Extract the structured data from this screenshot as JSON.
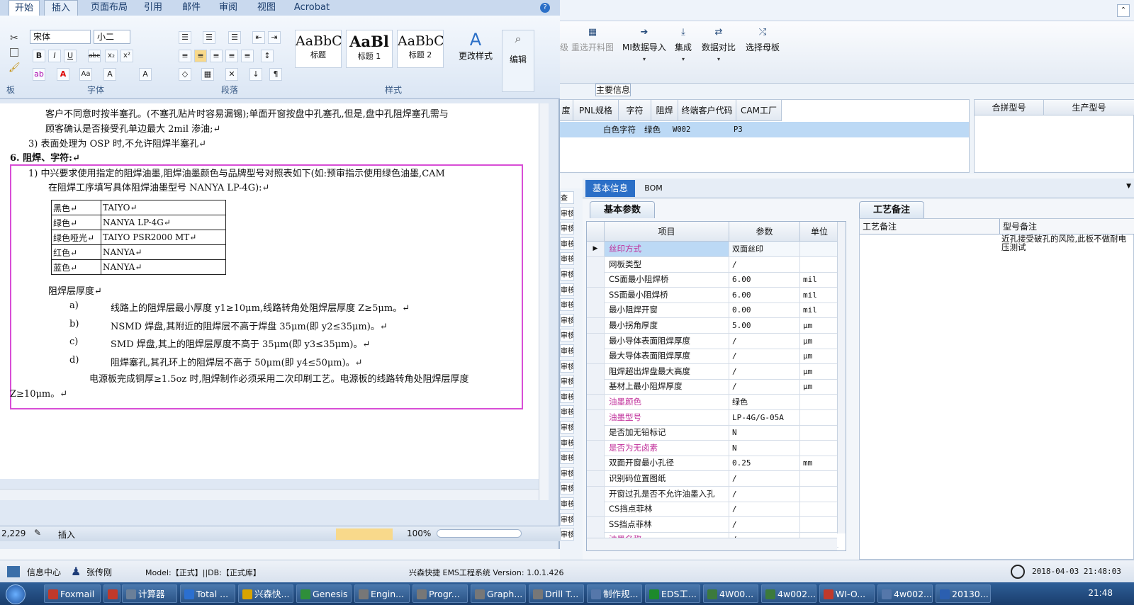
{
  "word": {
    "tabs": [
      "开始",
      "插入",
      "页面布局",
      "引用",
      "邮件",
      "审阅",
      "视图",
      "Acrobat"
    ],
    "font_name": "宋体",
    "font_size": "小二",
    "styles": [
      {
        "preview": "AaBbC",
        "label": "标题"
      },
      {
        "preview": "AaBl",
        "label": "标题 1"
      },
      {
        "preview": "AaBbC",
        "label": "标题 2"
      }
    ],
    "change_styles": "更改样式",
    "edit": "编辑",
    "groups": {
      "font": "字体",
      "paragraph": "段落",
      "styles": "样式",
      "clipboard": "板"
    },
    "doc": {
      "l1": "客户不同意时按半塞孔。(不塞孔贴片时容易漏锡);单面开窗按盘中孔塞孔,但是,盘中孔阻焊塞孔需与",
      "l2": "顾客确认是否接受孔单边最大 2mil 渗油;↵",
      "l3": "3)  表面处理为 OSP 时,不允许阻焊半塞孔↵",
      "l4": "6.   阻焊、字符:↵",
      "l5": "1) 中兴要求使用指定的阻焊油墨,阻焊油墨颜色与品牌型号对照表如下(如:预审指示使用绿色油墨,CAM",
      "l6": "在阻焊工序填写具体阻焊油墨型号 NANYA  LP-4G):↵",
      "ink_table": [
        [
          "黑色↵",
          "TAIYO↵"
        ],
        [
          "绿色↵",
          "NANYA  LP-4G↵"
        ],
        [
          "绿色哑光↵",
          "TAIYO   PSR2000  MT↵"
        ],
        [
          "红色↵",
          "NANYA↵"
        ],
        [
          "蓝色↵",
          "NANYA↵"
        ]
      ],
      "thick_title": "阻焊层厚度↵",
      "items": [
        {
          "k": "a)",
          "t": "线路上的阻焊层最小厚度 y1≥10μm,线路转角处阻焊层厚度 Z≥5μm。↵"
        },
        {
          "k": "b)",
          "t": "NSMD 焊盘,其附近的阻焊层不高于焊盘 35μm(即 y2≤35μm)。↵"
        },
        {
          "k": "c)",
          "t": "SMD 焊盘,其上的阻焊层厚度不高于 35μm(即 y3≤35μm)。↵"
        },
        {
          "k": "d)",
          "t": "阻焊塞孔,其孔环上的阻焊层不高于 50μm(即 y4≤50μm)。↵"
        }
      ],
      "l7": "电源板完成铜厚≥1.5oz 时,阻焊制作必须采用二次印刷工艺。电源板的线路转角处阻焊层厚度",
      "l8": "Z≥10μm。↵"
    },
    "status": {
      "page": "2,229",
      "mode": "插入",
      "zoom": "100%"
    }
  },
  "ems": {
    "toolbar": [
      {
        "label": "升级"
      },
      {
        "label": "重选开料图"
      },
      {
        "label": "MI数据导入"
      },
      {
        "label": "集成"
      },
      {
        "label": "数据对比"
      },
      {
        "label": "选择母板"
      }
    ],
    "main_info": "主要信息",
    "main_headers": [
      "度",
      "PNL规格",
      "字符",
      "阻焊",
      "终端客户代码",
      "CAM工厂"
    ],
    "main_row": [
      "白色字符",
      "绿色",
      "W002",
      "P3"
    ],
    "right_headers": [
      "合拼型号",
      "生产型号"
    ],
    "tabs": [
      "基本信息",
      "BOM"
    ],
    "basic_params": "基本参数",
    "craft_notes": "工艺备注",
    "param_headers": [
      "项目",
      "参数",
      "单位"
    ],
    "params": [
      {
        "name": "丝印方式",
        "value": "双面丝印",
        "unit": "",
        "hl": true
      },
      {
        "name": "网板类型",
        "value": "/",
        "unit": "",
        "hl": false
      },
      {
        "name": "CS面最小阻焊桥",
        "value": "6.00",
        "unit": "mil",
        "hl": false
      },
      {
        "name": "SS面最小阻焊桥",
        "value": "6.00",
        "unit": "mil",
        "hl": false
      },
      {
        "name": "最小阻焊开窗",
        "value": "0.00",
        "unit": "mil",
        "hl": false
      },
      {
        "name": "最小拐角厚度",
        "value": "5.00",
        "unit": "μm",
        "hl": false
      },
      {
        "name": "最小导体表面阻焊厚度",
        "value": "/",
        "unit": "μm",
        "hl": false
      },
      {
        "name": "最大导体表面阻焊厚度",
        "value": "/",
        "unit": "μm",
        "hl": false
      },
      {
        "name": "阻焊超出焊盘最大高度",
        "value": "/",
        "unit": "μm",
        "hl": false
      },
      {
        "name": "基材上最小阻焊厚度",
        "value": "/",
        "unit": "μm",
        "hl": false
      },
      {
        "name": "油墨颜色",
        "value": "绿色",
        "unit": "",
        "hl": true
      },
      {
        "name": "油墨型号",
        "value": "LP-4G/G-05A",
        "unit": "",
        "hl": true
      },
      {
        "name": "是否加无铅标记",
        "value": "N",
        "unit": "",
        "hl": false
      },
      {
        "name": "是否为无卤素",
        "value": "N",
        "unit": "",
        "hl": true
      },
      {
        "name": "双面开窗最小孔径",
        "value": "0.25",
        "unit": "mm",
        "hl": false
      },
      {
        "name": "识别码位置图纸",
        "value": "/",
        "unit": "",
        "hl": false
      },
      {
        "name": "开窗过孔是否不允许油墨入孔",
        "value": "/",
        "unit": "",
        "hl": false
      },
      {
        "name": "CS挡点菲林",
        "value": "/",
        "unit": "",
        "hl": false
      },
      {
        "name": "SS挡点菲林",
        "value": "/",
        "unit": "",
        "hl": false
      },
      {
        "name": "油墨名称",
        "value": "/",
        "unit": "",
        "hl": true
      }
    ],
    "notes_headers": [
      "工艺备注",
      "型号备注"
    ],
    "model_note": "近孔接受破孔的风险,此板不做耐电压测试",
    "left_col": [
      "查",
      "审核",
      "审核",
      "审核",
      "审核",
      "审核",
      "审核",
      "审核",
      "审核",
      "审核",
      "审核",
      "审核",
      "审核",
      "审核",
      "审核",
      "审核",
      "审核",
      "审核",
      "审核",
      "审核",
      "审核",
      "审核",
      "审核"
    ],
    "status": {
      "info_center": "信息中心",
      "user": "张传刚",
      "model": "Model:【正式】||DB:【正式库】",
      "sys": "兴森快捷 EMS工程系统 Version: 1.0.1.426",
      "datetime": "2018-04-03 21:48:03"
    }
  },
  "taskbar": {
    "items": [
      {
        "label": "Foxmail",
        "color": "#c0392b"
      },
      {
        "label": "",
        "color": "#c0392b"
      },
      {
        "label": "计算器",
        "color": "#6a7f99"
      },
      {
        "label": "Total ...",
        "color": "#2b6fd0"
      },
      {
        "label": "兴森快...",
        "color": "#d9a400"
      },
      {
        "label": "Genesis",
        "color": "#2f8f3a"
      },
      {
        "label": "Engin...",
        "color": "#777"
      },
      {
        "label": "Progr...",
        "color": "#777"
      },
      {
        "label": "Graph...",
        "color": "#777"
      },
      {
        "label": "Drill T...",
        "color": "#777"
      },
      {
        "label": "制作规...",
        "color": "#5577aa"
      },
      {
        "label": "EDS工...",
        "color": "#1d8a2b"
      },
      {
        "label": "4W00...",
        "color": "#3c7a3c"
      },
      {
        "label": "4w002...",
        "color": "#3c7a3c"
      },
      {
        "label": "WI-O...",
        "color": "#c0392b"
      },
      {
        "label": "4w002...",
        "color": "#5577aa"
      },
      {
        "label": "20130...",
        "color": "#2b5fb0"
      }
    ],
    "time": "21:48"
  }
}
